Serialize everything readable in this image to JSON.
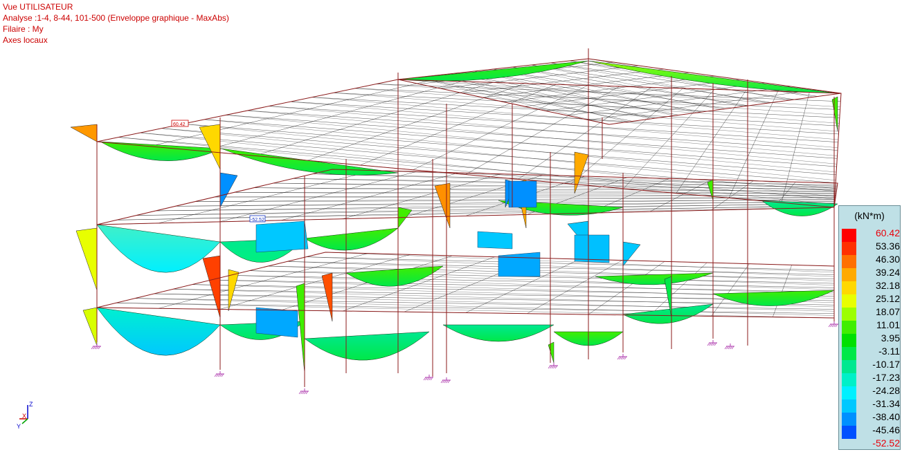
{
  "header": {
    "view_title": "Vue UTILISATEUR",
    "analysis": "Analyse :1-4, 8-44, 101-500 (Enveloppe graphique - MaxAbs)",
    "wire": "Filaire : My",
    "axes": "Axes locaux"
  },
  "annotations": {
    "max_label": "60.42",
    "min_label": "-52.52"
  },
  "legend": {
    "title": "(kN*m)",
    "rows": [
      {
        "value": "60.42",
        "color": "#ff0000"
      },
      {
        "value": "53.36",
        "color": "#ff3000"
      },
      {
        "value": "46.30",
        "color": "#ff7000"
      },
      {
        "value": "39.24",
        "color": "#ffaa00"
      },
      {
        "value": "32.18",
        "color": "#ffd800"
      },
      {
        "value": "25.12",
        "color": "#e8ff00"
      },
      {
        "value": "18.07",
        "color": "#9cff00"
      },
      {
        "value": "11.01",
        "color": "#40ee00"
      },
      {
        "value": "3.95",
        "color": "#00e000"
      },
      {
        "value": "-3.11",
        "color": "#00e848"
      },
      {
        "value": "-10.17",
        "color": "#00e890"
      },
      {
        "value": "-17.23",
        "color": "#00f0c8"
      },
      {
        "value": "-24.28",
        "color": "#00f0ff"
      },
      {
        "value": "-31.34",
        "color": "#00c8ff"
      },
      {
        "value": "-38.40",
        "color": "#0090ff"
      },
      {
        "value": "-45.46",
        "color": "#0050ff"
      },
      {
        "value": "-52.52",
        "color": "#0018ff"
      }
    ]
  },
  "triad": {
    "z": "Z",
    "x": "X",
    "y": "Y"
  },
  "colors": {
    "header_text": "#cc0000",
    "wire": "#8b1a1a",
    "mesh": "#000000",
    "support": "#b040b0"
  }
}
